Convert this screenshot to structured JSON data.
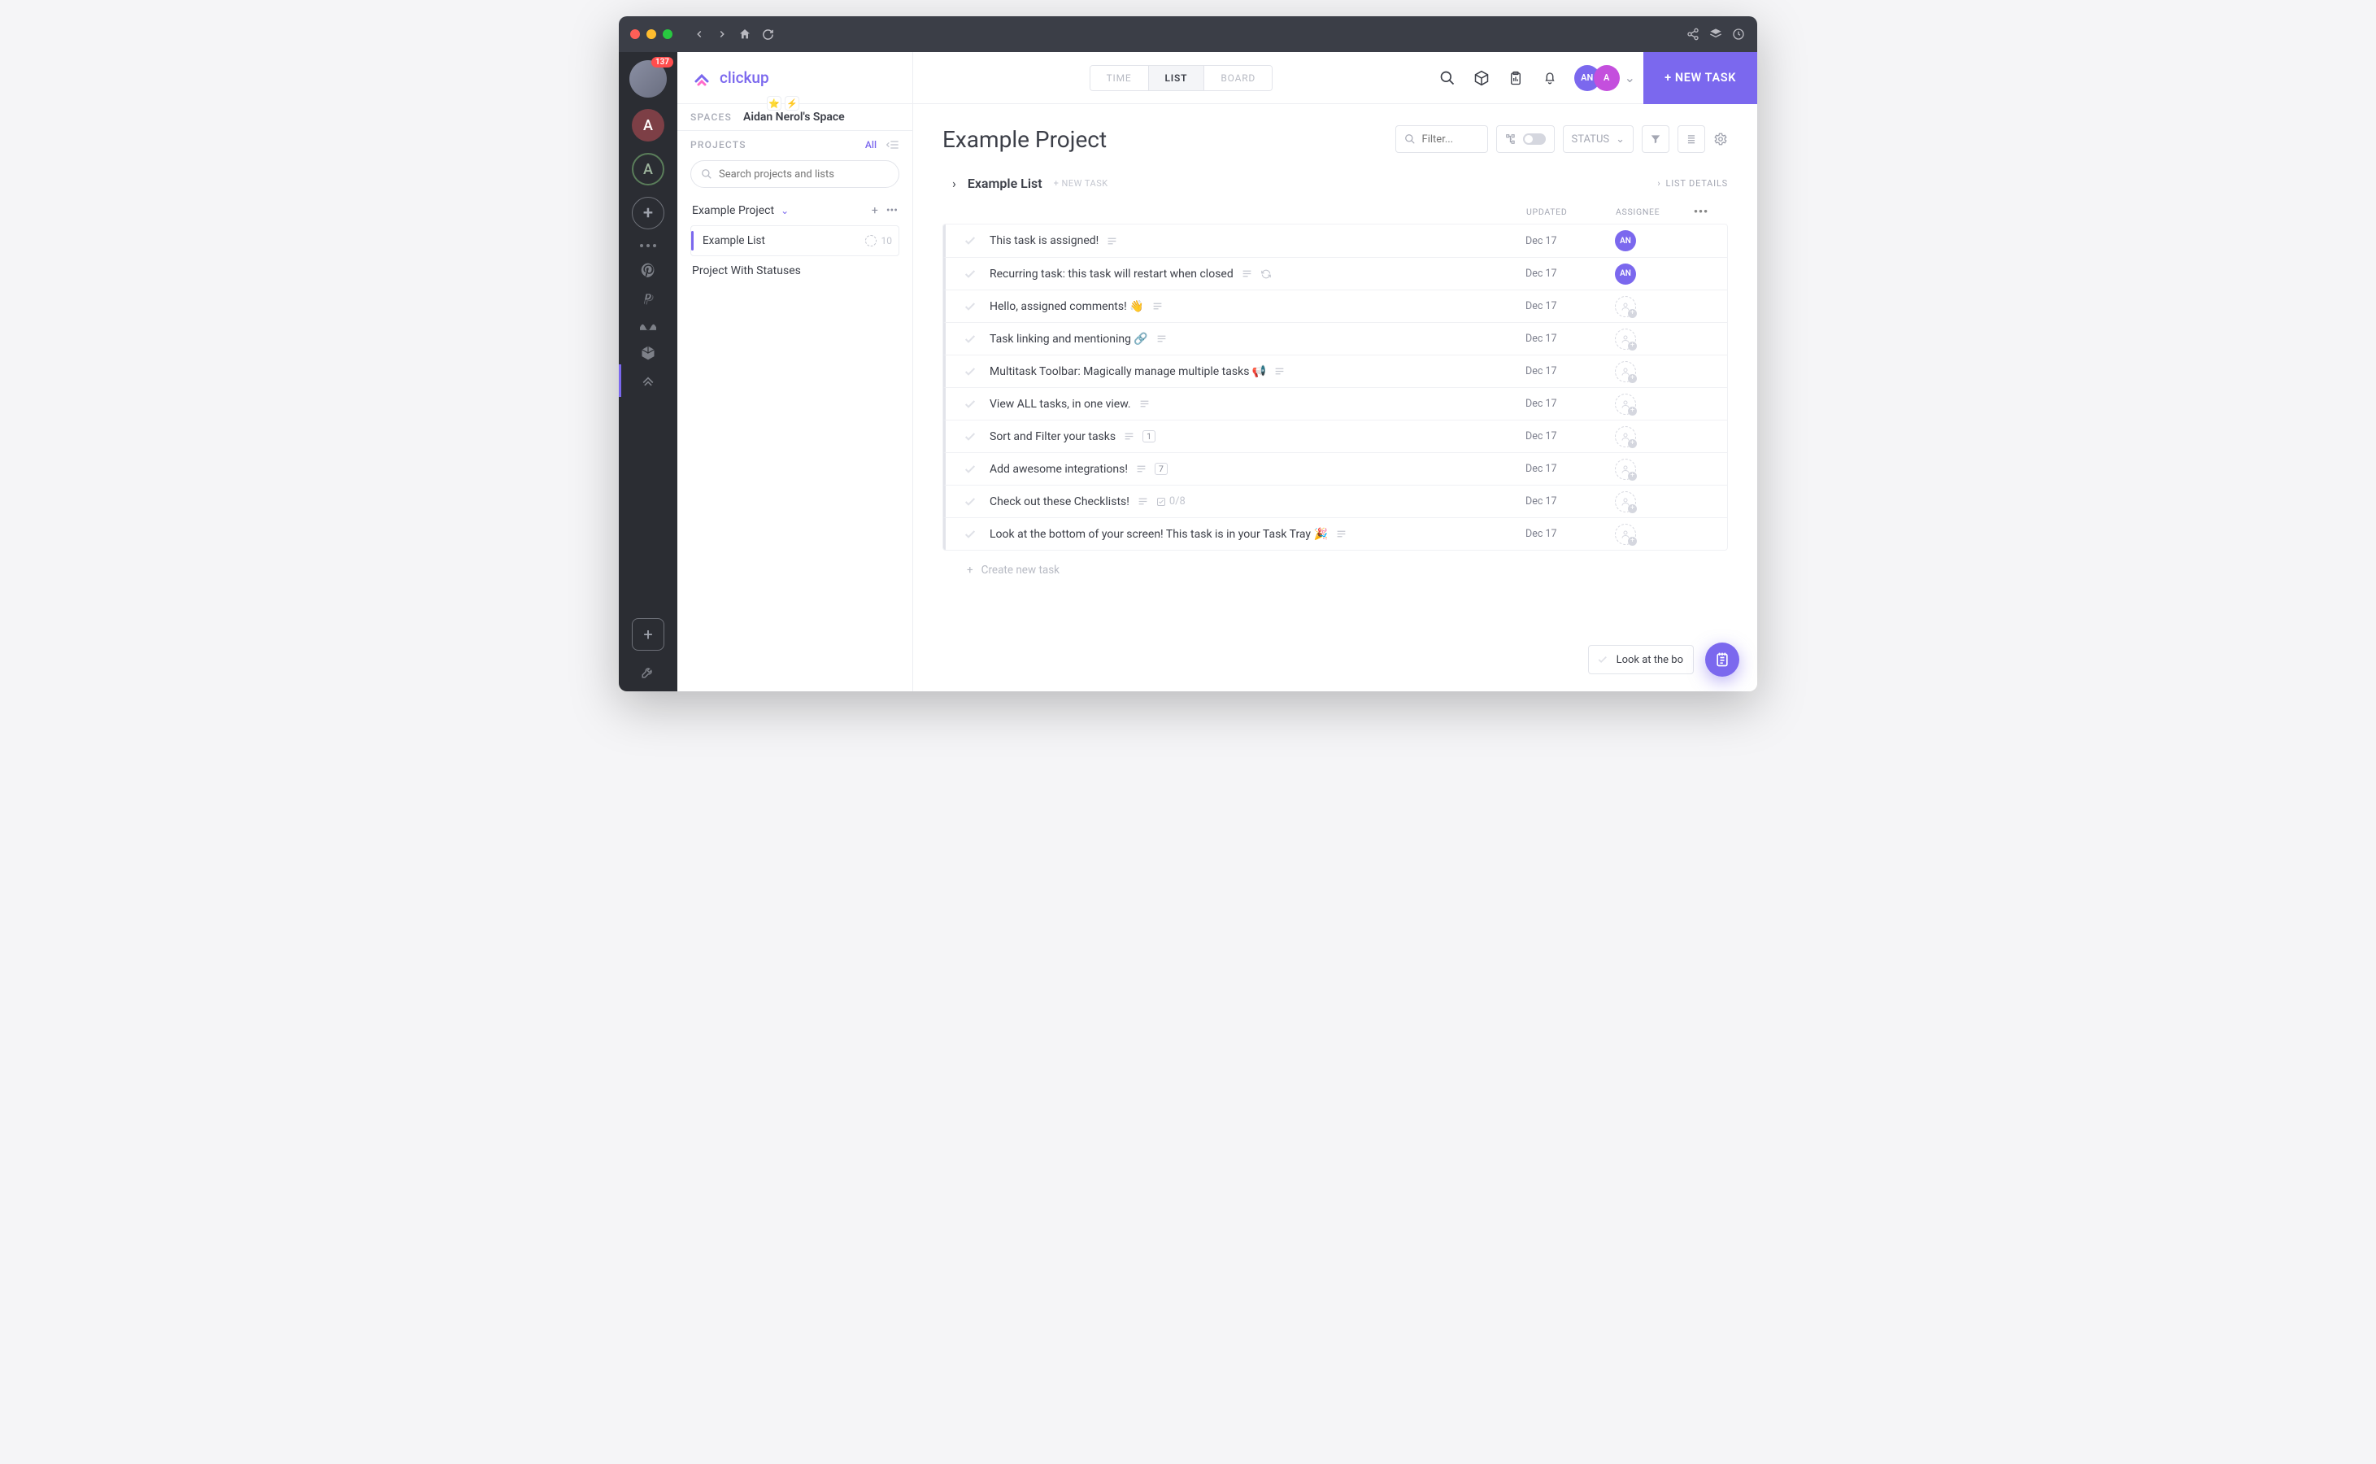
{
  "avatar_badge": "137",
  "workspaces": [
    "A",
    "A"
  ],
  "brand": "clickup",
  "spaces_label": "SPACES",
  "space_name": "Aidan Nerol's Space",
  "projects_label": "PROJECTS",
  "projects_all": "All",
  "search_placeholder": "Search projects and lists",
  "projects": {
    "p0": {
      "name": "Example Project"
    },
    "p0_list": {
      "name": "Example List",
      "count": "10"
    },
    "p1": {
      "name": "Project With Statuses"
    }
  },
  "views": {
    "time": "TIME",
    "list": "LIST",
    "board": "BOARD"
  },
  "avatars": [
    {
      "label": "AN",
      "color": "#7b68ee"
    },
    {
      "label": "A",
      "color": "#c44fdd"
    }
  ],
  "new_task_btn": "+ NEW TASK",
  "page_title": "Example Project",
  "filter_placeholder": "Filter...",
  "status_label": "STATUS",
  "list_name": "Example List",
  "new_task_inline": "+ NEW TASK",
  "list_details": "LIST DETAILS",
  "columns": {
    "updated": "UPDATED",
    "assignee": "ASSIGNEE"
  },
  "tasks": [
    {
      "title": "This task is assigned!",
      "updated": "Dec 17",
      "assignee": "AN",
      "assignee_color": "#7b68ee",
      "icons": [
        "desc"
      ]
    },
    {
      "title": "Recurring task: this task will restart when closed",
      "updated": "Dec 17",
      "assignee": "AN",
      "assignee_color": "#7b68ee",
      "icons": [
        "desc",
        "recur"
      ]
    },
    {
      "title": "Hello, assigned comments! 👋",
      "updated": "Dec 17",
      "icons": [
        "desc"
      ]
    },
    {
      "title": "Task linking and mentioning 🔗",
      "updated": "Dec 17",
      "icons": [
        "desc"
      ]
    },
    {
      "title": "Multitask Toolbar: Magically manage multiple tasks 📢",
      "updated": "Dec 17",
      "icons": [
        "desc"
      ]
    },
    {
      "title": "View ALL tasks, in one view.",
      "updated": "Dec 17",
      "icons": [
        "desc"
      ]
    },
    {
      "title": "Sort and Filter your tasks",
      "updated": "Dec 17",
      "icons": [
        "desc"
      ],
      "badge": "1"
    },
    {
      "title": "Add awesome integrations!",
      "updated": "Dec 17",
      "icons": [
        "desc"
      ],
      "badge": "7"
    },
    {
      "title": "Check out these Checklists!",
      "updated": "Dec 17",
      "icons": [
        "desc"
      ],
      "checklist": "0/8"
    },
    {
      "title": "Look at the bottom of your screen! This task is in your Task Tray 🎉",
      "updated": "Dec 17",
      "icons": [
        "desc"
      ]
    }
  ],
  "create_new": "Create new task",
  "tray_task": "Look at the bo"
}
